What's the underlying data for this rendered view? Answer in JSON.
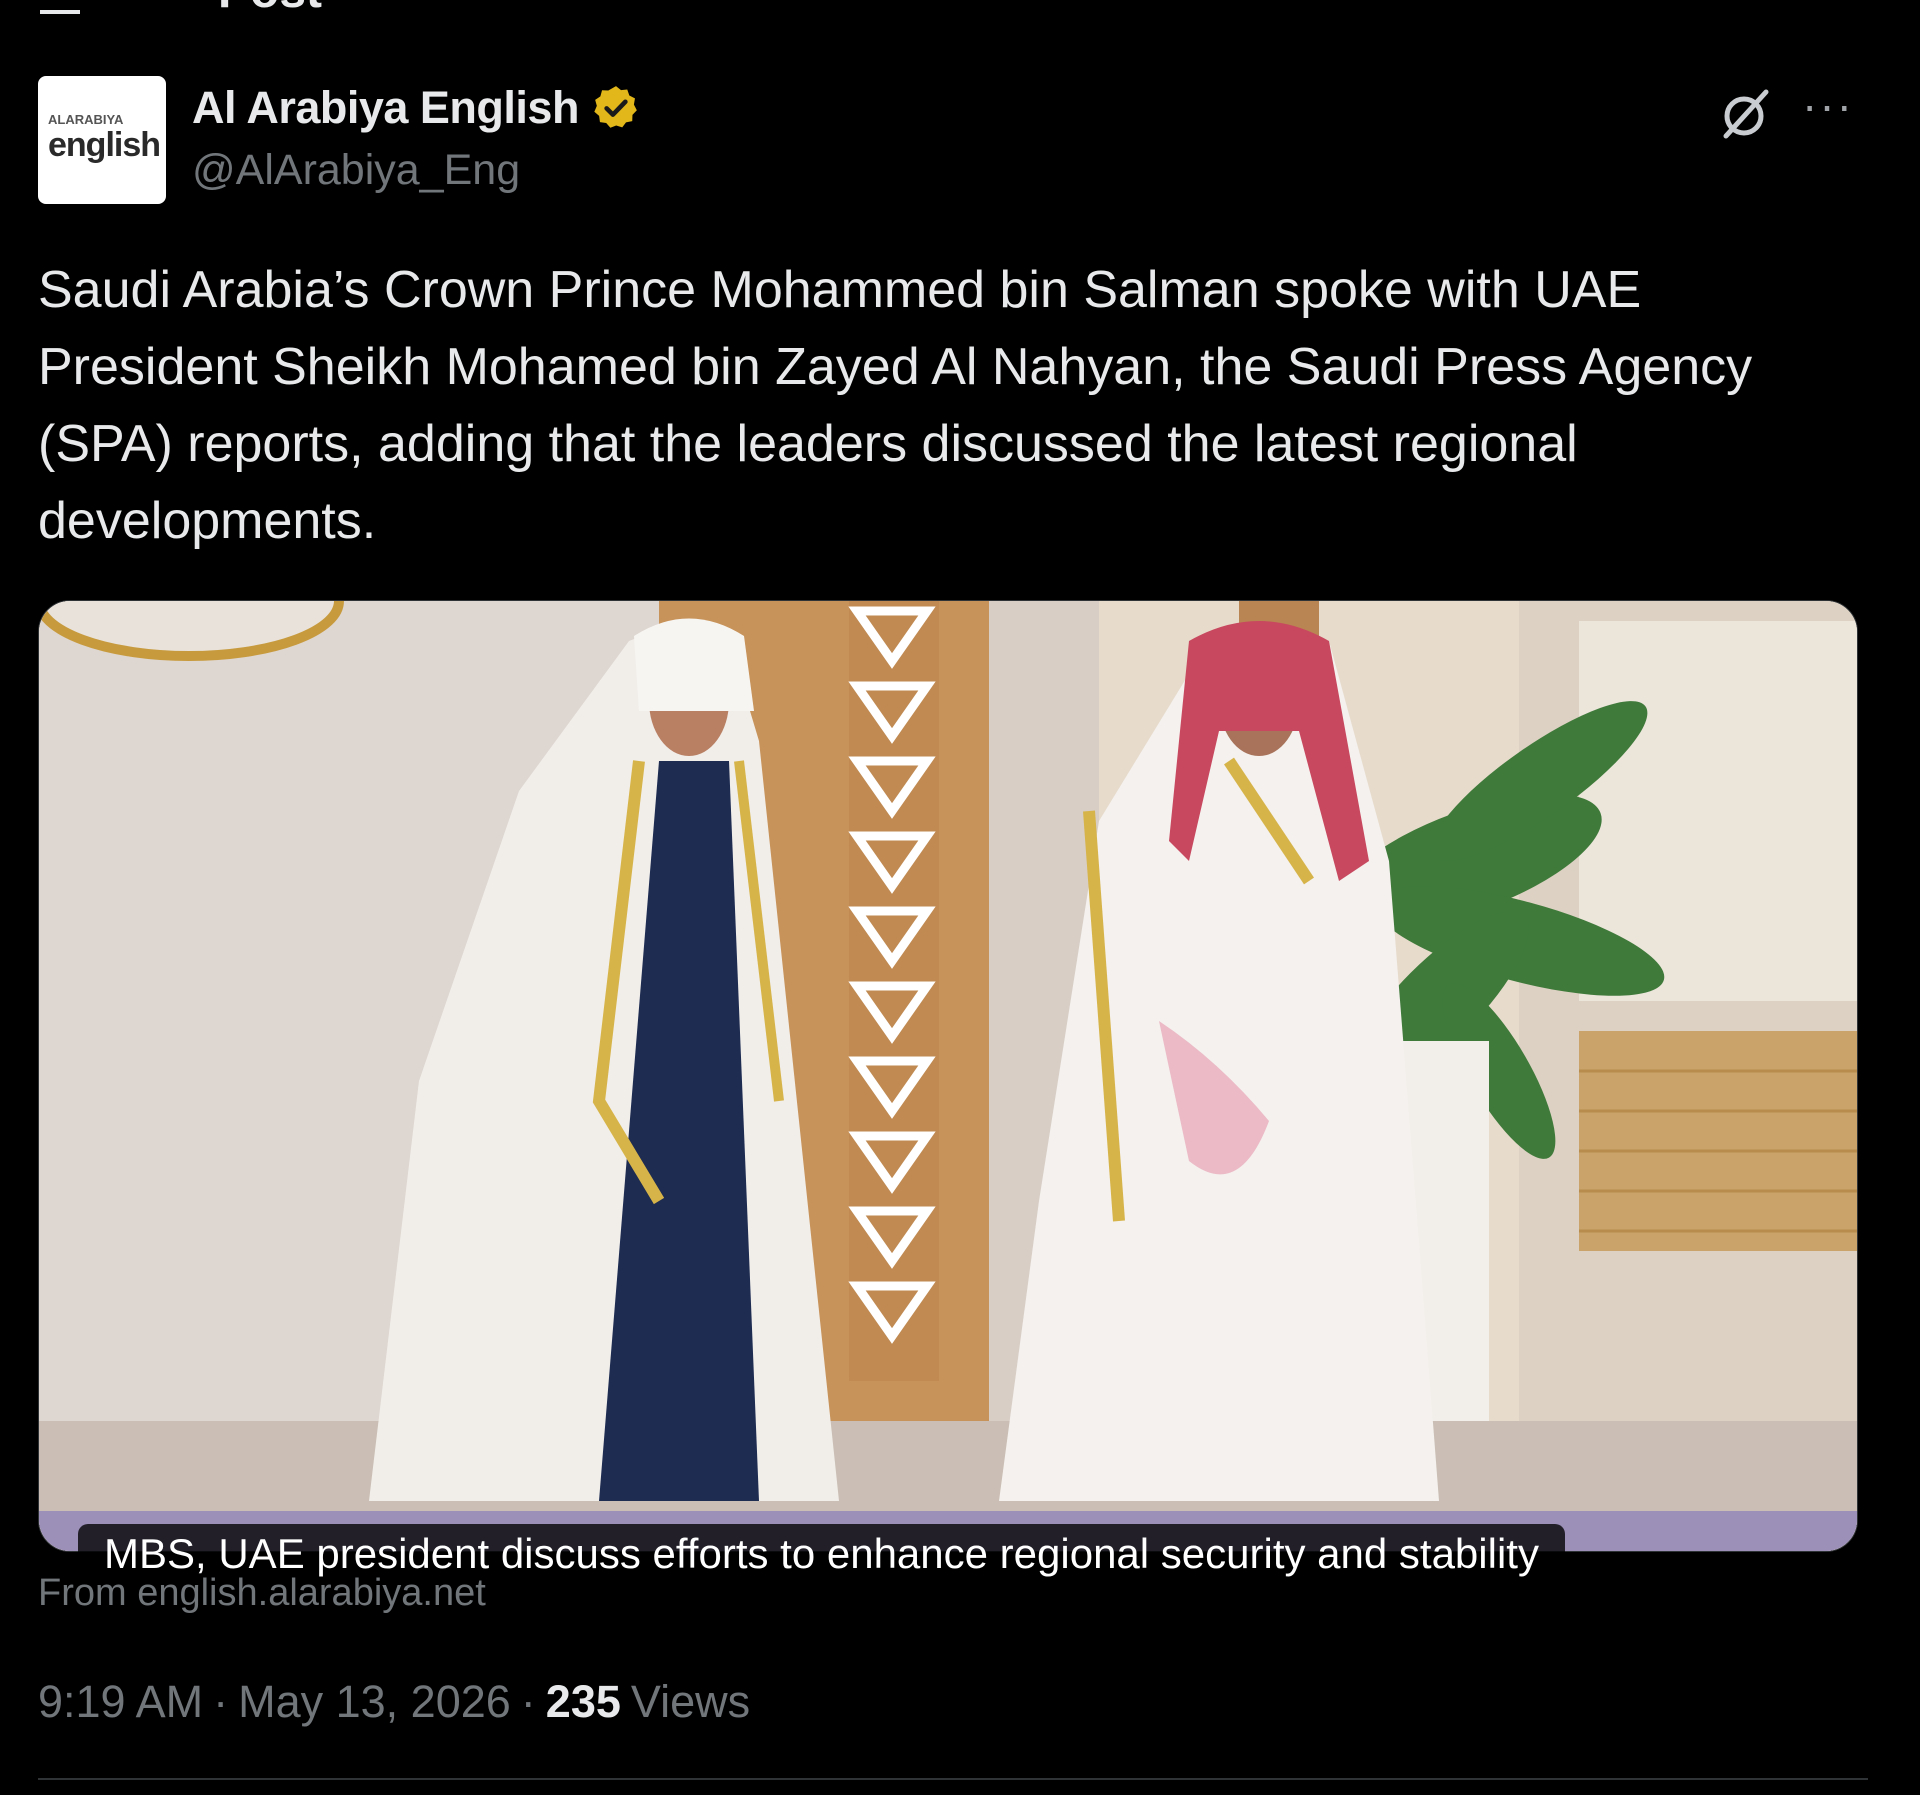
{
  "header": {
    "title": "Post"
  },
  "author": {
    "display_name": "Al Arabiya English",
    "handle": "@AlArabiya_Eng",
    "avatar_logo_top": "ALARABIYA",
    "avatar_logo_main": "english",
    "verified": true
  },
  "actions": {
    "grok_icon": "grok-icon",
    "more_icon": "more-icon",
    "more_glyph": "···"
  },
  "post": {
    "text": "Saudi Arabia’s Crown Prince Mohammed bin Salman spoke with UAE President Sheikh Mohamed bin Zayed Al Nahyan, the Saudi Press Agency (SPA) reports, adding that the leaders discussed the latest regional developments."
  },
  "media": {
    "caption": "MBS, UAE president discuss efforts to enhance regional security and stability",
    "source": "From english.alarabiya.net"
  },
  "meta": {
    "time": "9:19 AM",
    "separator": "·",
    "date": "May 13, 2026",
    "views_count": "235",
    "views_label": "Views"
  },
  "colors": {
    "background": "#000000",
    "text_primary": "#e7e9ea",
    "text_secondary": "#71767b",
    "verified_gold": "#e2b719"
  }
}
